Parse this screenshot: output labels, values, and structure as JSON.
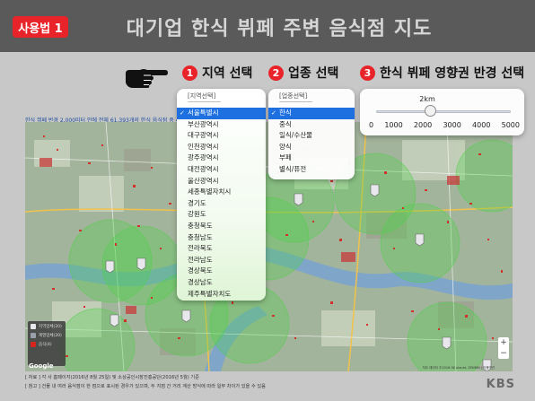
{
  "header": {
    "badge": "사용법 1",
    "title": "대기업 한식 뷔페 주변 음식점 지도"
  },
  "steps": [
    {
      "num": "1",
      "label": "지역 선택"
    },
    {
      "num": "2",
      "label": "업종 선택"
    },
    {
      "num": "3",
      "label": "한식 뷔페 영향권 반경 선택"
    }
  ],
  "map": {
    "caption": "한식 뷔페 반경 2,000미터 안에 전체 61,393개의 한식 음식점 중 45,082개",
    "legend": [
      "지역업체(20)",
      "계열업체(20)",
      "음식(4)"
    ],
    "google_logo": "Google",
    "attribution": "지도 데이터 ©2016 SK planet, ZENRIN | 이용약관",
    "zoom_in": "+",
    "zoom_out": "−"
  },
  "notes": [
    "[ 자료 ] 각 사 홈페이지(2016년 8월 25일) 및 소상공인시장진흥공단(2016년 5월) 기준",
    "[ 참고 ] 건물 내 여러 음식점이 한 점으로 표시된 경우가 있으며, 두 지점 간 거리 계산 방식에 따라 일부 차이가 있을 수 있음"
  ],
  "region_dropdown": {
    "placeholder": "[지역선택]",
    "separator": "----------------------",
    "selected": "서울특별시",
    "items": [
      "서울특별시",
      "부산광역시",
      "대구광역시",
      "인천광역시",
      "광주광역시",
      "대전광역시",
      "울산광역시",
      "세종특별자치시",
      "경기도",
      "강원도",
      "충청북도",
      "충청남도",
      "전라북도",
      "전라남도",
      "경상북도",
      "경상남도",
      "제주특별자치도"
    ]
  },
  "industry_dropdown": {
    "placeholder": "[업종선택]",
    "separator": "----------------------",
    "selected": "한식",
    "items": [
      "한식",
      "중식",
      "일식/수산물",
      "양식",
      "부페",
      "별식/퓨전"
    ]
  },
  "radius_slider": {
    "value_label": "2km",
    "value": 2000,
    "min": 0,
    "max": 5000,
    "ticks": [
      "0",
      "1000",
      "2000",
      "3000",
      "4000",
      "5000"
    ]
  },
  "watermark": "KBS",
  "colors": {
    "accent_red": "#e8242a",
    "selected_blue": "#1e6fe0",
    "circle_green": "#4fd04a",
    "dot_red": "#d8241e"
  }
}
